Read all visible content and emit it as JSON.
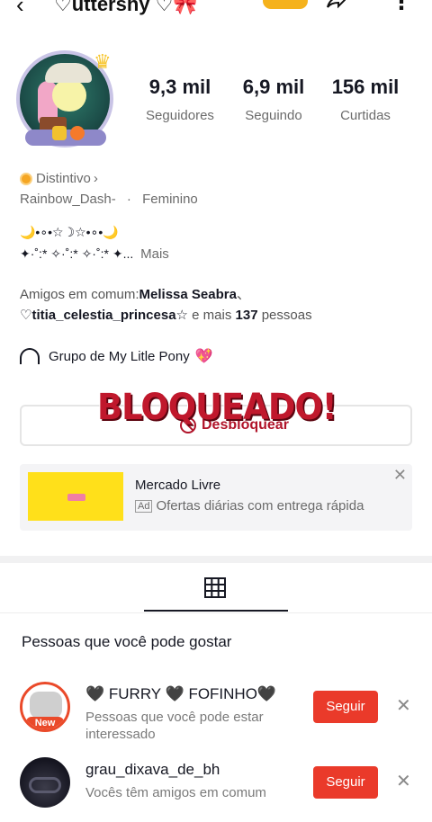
{
  "topbar": {
    "username": "♡uttershy ♡🎀"
  },
  "stats": [
    {
      "value": "9,3 mil",
      "label": "Seguidores"
    },
    {
      "value": "6,9 mil",
      "label": "Seguindo"
    },
    {
      "value": "156 mil",
      "label": "Curtidas"
    }
  ],
  "profile": {
    "badge": "Distintivo",
    "handle": "Rainbow_Dash-",
    "separator": "·",
    "gender": "Feminino",
    "bio_line1": "🌙•∘•☆☽☆•∘•🌙",
    "bio_line2": "✦·˚:* ✧·˚:* ✧·˚:* ✦...",
    "more": "Mais"
  },
  "mutual": {
    "prefix": "Amigos em comum:",
    "name1": "Melissa Seabra",
    "sep": "、",
    "name2": "♡titia_celestia_princesa☆",
    "middle": " e mais ",
    "count": "137",
    "suffix": " pessoas"
  },
  "group": {
    "label": "Grupo de My Litle Pony",
    "emoji": "💖"
  },
  "blocked_overlay": "BLOQUEADO!",
  "unblock": {
    "label": "Desbloquear"
  },
  "ad": {
    "title": "Mercado Livre",
    "tag": "Ad",
    "description": "Ofertas diárias com entrega rápida",
    "close": "✕"
  },
  "suggestions": {
    "title": "Pessoas que você pode gostar",
    "items": [
      {
        "name": "🖤 FURRY 🖤 FOFINHO🖤",
        "reason": "Pessoas que você pode estar interessado",
        "badge": "New",
        "follow": "Seguir",
        "dismiss": "✕"
      },
      {
        "name": "grau_dixava_de_bh",
        "reason": "Vocês têm amigos em comum",
        "follow": "Seguir",
        "dismiss": "✕"
      }
    ]
  },
  "colors": {
    "follow_button": "#ea3a2a",
    "blocked_red": "#c0182c",
    "unblock_red": "#b1142a",
    "ad_yellow": "#ffe01a"
  },
  "icons": {
    "back": "back-arrow-icon",
    "share": "share-icon",
    "more": "more-icon",
    "grid": "grid-icon",
    "group": "group-icon",
    "ban": "ban-icon"
  }
}
